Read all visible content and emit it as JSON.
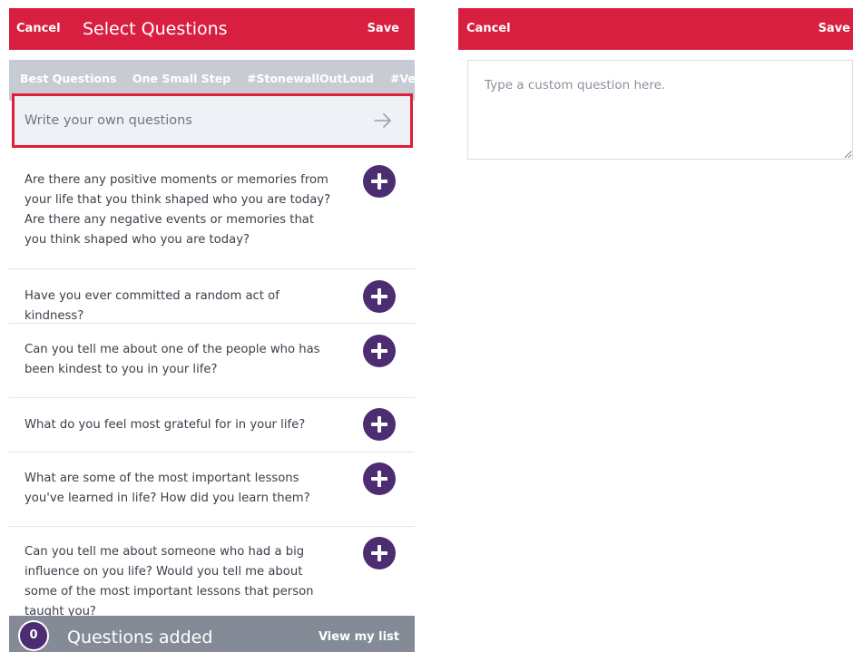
{
  "select_screen": {
    "header": {
      "cancel_label": "Cancel",
      "title": "Select Questions",
      "save_label": "Save"
    },
    "tabs": [
      {
        "label": "Best Questions",
        "active": true
      },
      {
        "label": "One Small Step",
        "active": false
      },
      {
        "label": "#StonewallOutLoud",
        "active": false
      },
      {
        "label": "#Vet",
        "active": false
      }
    ],
    "custom_row": {
      "label": "Write your own questions",
      "icon": "arrow-right-icon"
    },
    "questions": [
      {
        "text": "Are there any positive moments or memories from your life that you think shaped who you are today? Are there any negative events or memories that you think shaped who you are today?"
      },
      {
        "text": "Have you ever committed a random act of kindness?"
      },
      {
        "text": "Can you tell me about one of the people who has been kindest to you in your life?"
      },
      {
        "text": "What do you feel most grateful for in your life?"
      },
      {
        "text": "What are some of the most important lessons you've learned in life? How did you learn them?"
      },
      {
        "text": "Can you tell me about someone who had a big influence on you life? Would you tell me about some of the most important lessons that person taught you?"
      }
    ],
    "footer": {
      "count": "0",
      "label": "Questions added",
      "view_label": "View my list"
    }
  },
  "custom_screen": {
    "header": {
      "cancel_label": "Cancel",
      "save_label": "Save"
    },
    "textarea": {
      "placeholder": "Type a custom question here.",
      "value": ""
    }
  },
  "colors": {
    "header_red": "#d81f3f",
    "highlight_red": "#e11d3a",
    "purple": "#4c2d72",
    "tab_bar_gray": "#c7ccd4",
    "footer_gray": "#848b97"
  }
}
